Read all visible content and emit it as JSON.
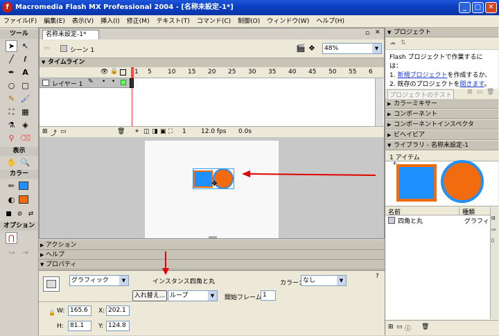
{
  "window": {
    "title": "Macromedia Flash MX Professional 2004 - [名称未設定-1*]",
    "logo": "f"
  },
  "menu": [
    "ファイル(F)",
    "編集(E)",
    "表示(V)",
    "挿入(I)",
    "修正(M)",
    "テキスト(T)",
    "コマンド(C)",
    "制御(O)",
    "ウィンドウ(W)",
    "ヘルプ(H)"
  ],
  "tools": {
    "header": "ツール",
    "view": "表示",
    "colors": "カラー",
    "options": "オプション"
  },
  "document": {
    "tab": "名称未設定-1*",
    "scene": "シーン 1",
    "zoom": "48%",
    "timeline_label": "タイムライン",
    "layer_name": "レイヤー 1",
    "frame_numbers": [
      "1",
      "5",
      "10",
      "15",
      "20",
      "25",
      "30",
      "35",
      "40",
      "45",
      "50",
      "55",
      "6"
    ],
    "current_frame": "1",
    "fps": "12.0 fps",
    "elapsed": "0.0s"
  },
  "panels": {
    "actions": "アクション",
    "help": "ヘルプ",
    "properties": "プロパティ"
  },
  "properties": {
    "symbol_type": "グラフィック",
    "instance_label": "インスタンス：",
    "instance_name": "四角と丸",
    "color_label": "カラー：",
    "color_value": "なし",
    "swap_button": "入れ替え...",
    "loop_value": "ループ",
    "first_frame_label": "開始フレーム：",
    "first_frame": "1",
    "w_label": "W:",
    "w": "165.6",
    "h_label": "H:",
    "h": "81.1",
    "x_label": "X:",
    "x": "202.1",
    "y_label": "Y:",
    "y": "124.8"
  },
  "right_panel": {
    "project_header": "プロジェクト",
    "project_msg": "Flash プロジェクトで作業するには：",
    "step1_num": "1.",
    "step1_link": "新規プロジェクト",
    "step1_rest": "を作成するか、",
    "step2_num": "2.",
    "step2_pre": "既存のプロジェクトを",
    "step2_link": "開きます",
    "step2_post": "。",
    "test_project": "プロジェクトのテスト",
    "color_mixer": "カラーミキサー",
    "components": "コンポーネント",
    "component_inspector": "コンポーネントインスペクタ",
    "behaviors": "ビヘイビア",
    "library_header": "ライブラリ - 名称未設定-1",
    "item_count": "1 アイテム",
    "col_name": "名前",
    "col_kind": "種類",
    "item_name": "四角と丸",
    "item_kind": "グラフィック"
  },
  "colors": {
    "accent_blue": "#1e90ff",
    "accent_orange": "#f26b0f",
    "arrow_red": "#e00000"
  }
}
